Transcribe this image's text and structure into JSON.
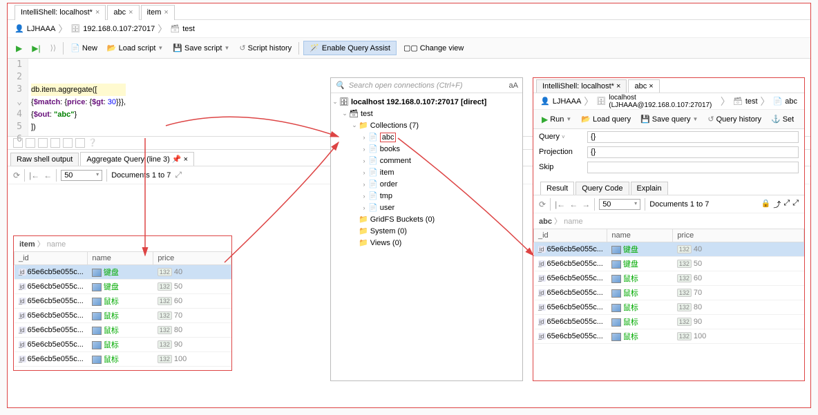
{
  "tabs": [
    {
      "label": "IntelliShell: localhost*"
    },
    {
      "label": "abc"
    },
    {
      "label": "item"
    }
  ],
  "breadcrumb": {
    "user": "LJHAAA",
    "host": "192.168.0.107:27017",
    "db": "test"
  },
  "toolbar": {
    "new": "New",
    "load": "Load script",
    "save": "Save script",
    "history": "Script history",
    "assist": "Enable Query Assist",
    "view": "Change view"
  },
  "code": {
    "l1": "",
    "l2": "",
    "l3a": "db.item.aggregate([",
    "l4a": "    {",
    "l4b": "$match",
    "l4c": ": {",
    "l4d": "price",
    "l4e": ": {",
    "l4f": "$gt",
    "l4g": ": ",
    "l4h": "30",
    "l4i": "}}},",
    "l5a": "    {",
    "l5b": "$out",
    "l5c": ": ",
    "l5d": "\"abc\"",
    "l5e": "}",
    "l6": "])"
  },
  "result_tabs": {
    "raw": "Raw shell output",
    "agg": "Aggregate Query (line 3)"
  },
  "nav": {
    "page": "50",
    "docs": "Documents 1 to 7"
  },
  "left_crumb": {
    "main": "item",
    "sub": "name"
  },
  "columns": {
    "id": "_id",
    "name": "name",
    "price": "price"
  },
  "rows": [
    {
      "id": "65e6cb5e055c...",
      "name": "键盘",
      "price": "40",
      "sel": true
    },
    {
      "id": "65e6cb5e055c...",
      "name": "键盘",
      "price": "50"
    },
    {
      "id": "65e6cb5e055c...",
      "name": "鼠标",
      "price": "60"
    },
    {
      "id": "65e6cb5e055c...",
      "name": "鼠标",
      "price": "70"
    },
    {
      "id": "65e6cb5e055c...",
      "name": "鼠标",
      "price": "80"
    },
    {
      "id": "65e6cb5e055c...",
      "name": "鼠标",
      "price": "90"
    },
    {
      "id": "65e6cb5e055c...",
      "name": "鼠标",
      "price": "100"
    }
  ],
  "tree": {
    "search": "Search open connections (Ctrl+F)",
    "aa": "aA",
    "root": "localhost 192.168.0.107:27017 [direct]",
    "db": "test",
    "coll": "Collections (7)",
    "items": [
      "abc",
      "books",
      "comment",
      "item",
      "order",
      "tmp",
      "user"
    ],
    "gridfs": "GridFS Buckets (0)",
    "system": "System (0)",
    "views": "Views (0)"
  },
  "right": {
    "tabs": [
      "IntelliShell: localhost*",
      "abc"
    ],
    "bc_user": "LJHAAA",
    "bc_host": "localhost (LJHAAA@192.168.0.107:27017)",
    "bc_db": "test",
    "bc_coll": "abc",
    "tb": {
      "run": "Run",
      "load": "Load query",
      "save": "Save query",
      "hist": "Query history",
      "set": "Set"
    },
    "form": {
      "query": "Query",
      "qv": "{}",
      "proj": "Projection",
      "pv": "{}",
      "skip": "Skip"
    },
    "rtabs": [
      "Result",
      "Query Code",
      "Explain"
    ],
    "nav": {
      "page": "50",
      "docs": "Documents 1 to 7"
    },
    "crumb": {
      "main": "abc",
      "sub": "name"
    }
  }
}
